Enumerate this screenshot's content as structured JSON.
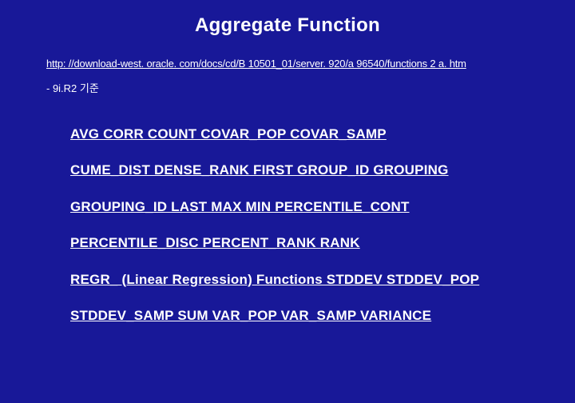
{
  "title": "Aggregate Function",
  "url": "http: //download-west. oracle. com/docs/cd/B 10501_01/server. 920/a 96540/functions 2 a. htm",
  "subnote": "- 9i.R2 기준",
  "lines": [
    "AVG CORR COUNT COVAR_POP COVAR_SAMP",
    "CUME_DIST DENSE_RANK FIRST GROUP_ID GROUPING",
    "GROUPING_ID LAST MAX MIN PERCENTILE_CONT",
    "PERCENTILE_DISC PERCENT_RANK RANK",
    "REGR_ (Linear Regression) Functions STDDEV STDDEV_POP",
    "STDDEV_SAMP SUM VAR_POP VAR_SAMP VARIANCE"
  ]
}
